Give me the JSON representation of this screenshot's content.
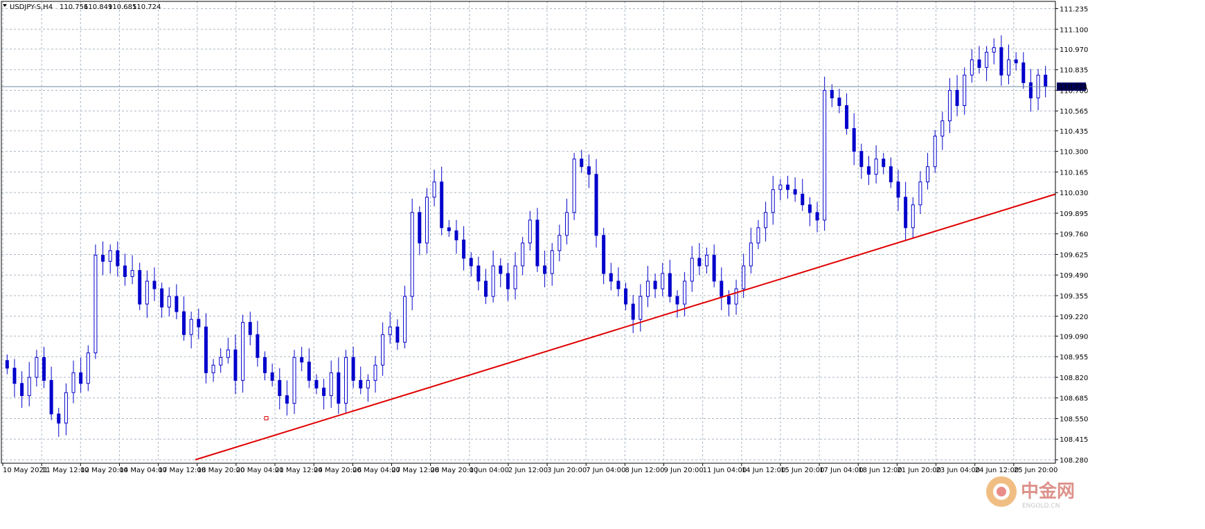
{
  "header": {
    "symbol": "USDJPY-S,H4",
    "open": "110.756",
    "high": "110.849",
    "low": "110.685",
    "close": "110.724"
  },
  "watermark": {
    "cn": "中金网",
    "en": "ENGOLD.CN"
  },
  "colors": {
    "background": "#ffffff",
    "candle": "#0000cc",
    "grid": "#a9b6c4",
    "trendline": "#e00000",
    "price_tag_bg": "#00005a",
    "price_line": "#6f8aa0"
  },
  "chart_data": {
    "type": "candlestick",
    "title": "USDJPY-S,H4",
    "ylim": [
      108.28,
      111.26
    ],
    "current_price": "110.724",
    "y_ticks": [
      "111.235",
      "111.100",
      "110.970",
      "110.835",
      "110.700",
      "110.565",
      "110.435",
      "110.300",
      "110.165",
      "110.030",
      "109.895",
      "109.760",
      "109.625",
      "109.490",
      "109.355",
      "109.220",
      "109.090",
      "108.955",
      "108.820",
      "108.685",
      "108.550",
      "108.415",
      "108.280"
    ],
    "x_labels": [
      "10 May 2021",
      "11 May 12:00",
      "12 May 20:00",
      "14 May 04:00",
      "17 May 12:00",
      "18 May 20:00",
      "20 May 04:00",
      "21 May 12:00",
      "24 May 20:00",
      "26 May 04:00",
      "27 May 12:00",
      "28 May 20:00",
      "1 Jun 04:00",
      "2 Jun 12:00",
      "3 Jun 20:00",
      "7 Jun 04:00",
      "8 Jun 12:00",
      "9 Jun 20:00",
      "11 Jun 04:00",
      "14 Jun 12:00",
      "15 Jun 20:00",
      "17 Jun 04:00",
      "18 Jun 12:00",
      "21 Jun 20:00",
      "23 Jun 04:00",
      "24 Jun 12:00",
      "25 Jun 20:00"
    ],
    "closes": [
      108.88,
      108.78,
      108.7,
      108.82,
      108.95,
      108.8,
      108.58,
      108.52,
      108.72,
      108.85,
      108.78,
      108.98,
      109.62,
      109.58,
      109.65,
      109.55,
      109.48,
      109.52,
      109.3,
      109.45,
      109.4,
      109.28,
      109.35,
      109.25,
      109.1,
      109.2,
      109.15,
      108.85,
      108.9,
      108.95,
      109.0,
      108.8,
      109.18,
      109.1,
      108.95,
      108.85,
      108.8,
      108.7,
      108.65,
      108.95,
      108.92,
      108.8,
      108.75,
      108.7,
      108.85,
      108.65,
      108.95,
      108.8,
      108.75,
      108.8,
      108.9,
      109.1,
      109.15,
      109.05,
      109.35,
      109.9,
      109.7,
      110.0,
      110.1,
      109.8,
      109.78,
      109.72,
      109.6,
      109.55,
      109.45,
      109.35,
      109.55,
      109.5,
      109.4,
      109.55,
      109.7,
      109.85,
      109.55,
      109.5,
      109.65,
      109.75,
      109.9,
      110.25,
      110.2,
      110.15,
      109.75,
      109.5,
      109.45,
      109.4,
      109.3,
      109.2,
      109.35,
      109.45,
      109.4,
      109.5,
      109.35,
      109.3,
      109.45,
      109.6,
      109.55,
      109.62,
      109.45,
      109.35,
      109.3,
      109.4,
      109.55,
      109.7,
      109.8,
      109.9,
      110.05,
      110.08,
      110.05,
      110.02,
      109.95,
      109.9,
      109.85,
      110.7,
      110.65,
      110.6,
      110.45,
      110.3,
      110.2,
      110.15,
      110.25,
      110.2,
      110.1,
      110.0,
      109.8,
      109.95,
      110.1,
      110.2,
      110.4,
      110.5,
      110.7,
      110.6,
      110.8,
      110.9,
      110.85,
      110.95,
      110.98,
      110.8,
      110.9,
      110.88,
      110.75,
      110.65,
      110.8,
      110.724
    ]
  }
}
